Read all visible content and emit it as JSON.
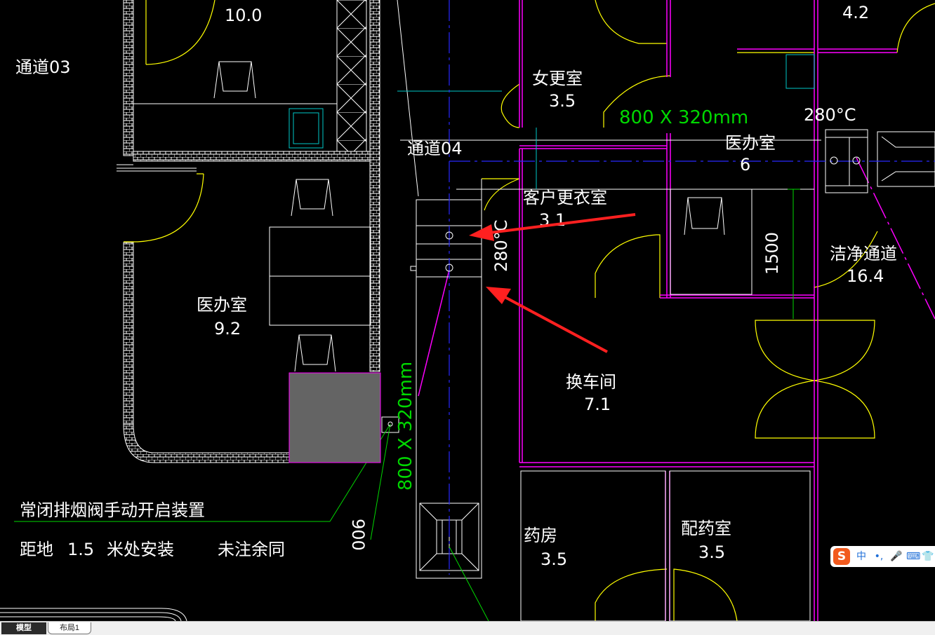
{
  "drawing": {
    "rooms": [
      {
        "name": "医办室",
        "area": "9.2"
      },
      {
        "name": "女更室",
        "area": "3.5"
      },
      {
        "name": "客户更衣室",
        "area": "3.1"
      },
      {
        "name": "医办室",
        "area": "6"
      },
      {
        "name": "洁净通道",
        "area": "16.4"
      },
      {
        "name": "换车间",
        "area": "7.1"
      },
      {
        "name": "药房",
        "area": "3.5"
      },
      {
        "name": "配药室",
        "area": "3.5"
      }
    ],
    "area_top_left": "10.0",
    "area_top_right": "4.2",
    "corridor_03": "通道03",
    "corridor_04": "通道04",
    "duct_size_h": "800 X 320mm",
    "duct_size_v": "800 X 320mm",
    "temp_label": "280°C",
    "dim_280": "280°C",
    "dim_1500": "1500",
    "dim_900": "900",
    "note_line1": "常闭排烟阀手动开启装置",
    "note_line2_a": "距地",
    "note_line2_b": "1.5",
    "note_line2_c": "米处安装",
    "note_line2_d": "未注余同",
    "colors": {
      "wall": "#ffffff",
      "door": "#ffff00",
      "partition": "#ff00ff",
      "duct_text": "#00ff00",
      "axis": "#0000ff",
      "cyan": "#00c8c8",
      "arrow": "#ff2020",
      "gray_block": "#646464"
    }
  },
  "tabs": [
    {
      "label": "模型"
    },
    {
      "label": "布局1"
    }
  ],
  "ime": {
    "logo": "S",
    "lang": "中",
    "punct": "•,",
    "icons": [
      "microphone-icon",
      "keyboard-icon",
      "skin-icon"
    ]
  }
}
